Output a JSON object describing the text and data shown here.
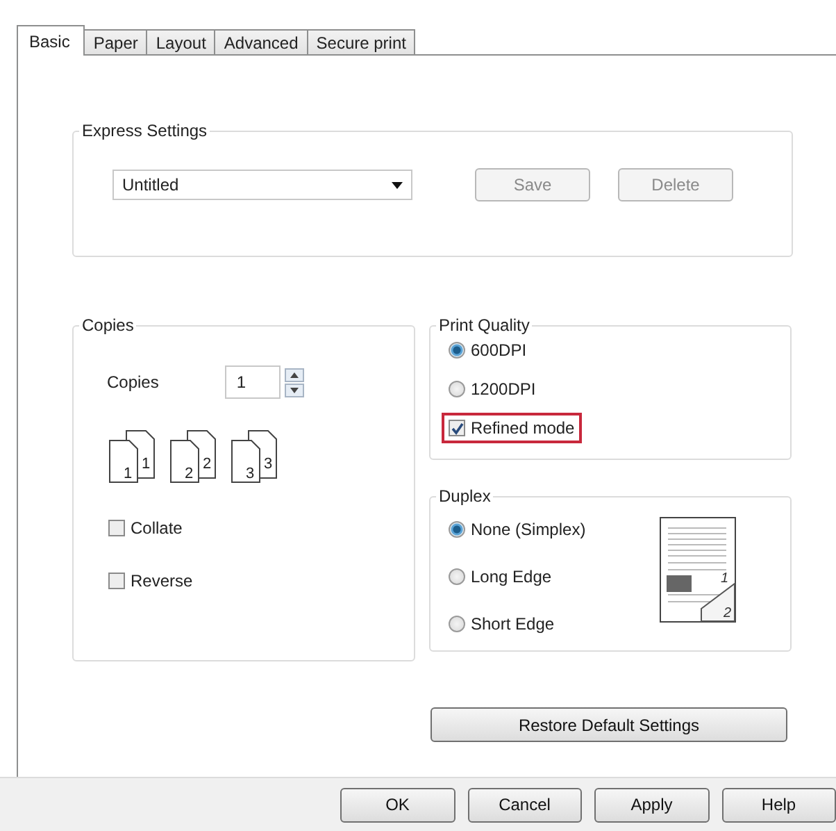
{
  "tabs": [
    {
      "label": "Basic",
      "selected": true
    },
    {
      "label": "Paper",
      "selected": false
    },
    {
      "label": "Layout",
      "selected": false
    },
    {
      "label": "Advanced",
      "selected": false
    },
    {
      "label": "Secure print",
      "selected": false
    }
  ],
  "express_settings": {
    "title": "Express Settings",
    "preset": "Untitled",
    "buttons": [
      {
        "label": "Save",
        "disabled": true
      },
      {
        "label": "Delete",
        "disabled": true
      }
    ]
  },
  "copies": {
    "title": "Copies",
    "label": "Copies",
    "value": "1",
    "page_numbers": [
      {
        "front": "1",
        "back": "1"
      },
      {
        "front": "2",
        "back": "2"
      },
      {
        "front": "3",
        "back": "3"
      }
    ],
    "options": [
      {
        "label": "Collate",
        "checked": false
      },
      {
        "label": "Reverse",
        "checked": false
      }
    ]
  },
  "print_quality": {
    "title": "Print Quality",
    "options": [
      {
        "kind": "radio",
        "label": "600DPI",
        "selected": true,
        "highlighted": false
      },
      {
        "kind": "radio",
        "label": "1200DPI",
        "selected": false,
        "highlighted": false
      },
      {
        "kind": "checkbox",
        "label": "Refined mode",
        "checked": true,
        "highlighted": true
      }
    ]
  },
  "duplex": {
    "title": "Duplex",
    "options": [
      {
        "label": "None (Simplex)",
        "selected": true
      },
      {
        "label": "Long Edge",
        "selected": false
      },
      {
        "label": "Short Edge",
        "selected": false
      }
    ],
    "preview_pages": [
      "1",
      "2"
    ]
  },
  "restore_button": "Restore Default Settings",
  "buttons": [
    "OK",
    "Cancel",
    "Apply",
    "Help"
  ]
}
